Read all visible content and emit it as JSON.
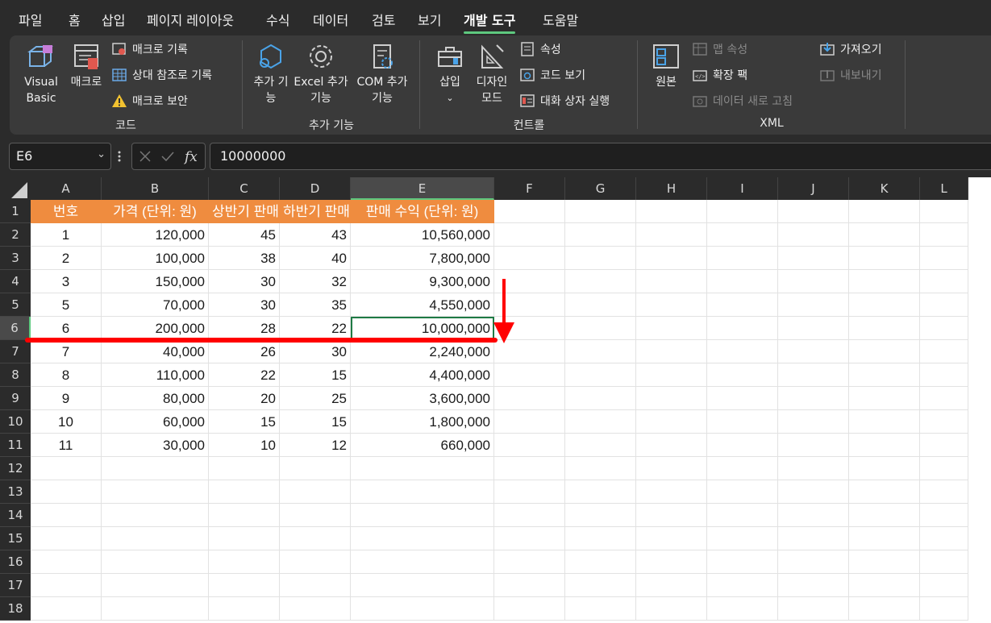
{
  "menu": {
    "tabs": [
      "파일",
      "홈",
      "삽입",
      "페이지 레이아웃",
      "수식",
      "데이터",
      "검토",
      "보기",
      "개발 도구",
      "도움말"
    ],
    "active_tab": "개발 도구"
  },
  "ribbon": {
    "code": {
      "label": "코드",
      "visual_basic": "Visual Basic",
      "macro": "매크로",
      "record_macro": "매크로 기록",
      "relative_ref": "상대 참조로 기록",
      "macro_security": "매크로 보안"
    },
    "addins": {
      "label": "추가 기능",
      "addins": "추가 기능",
      "excel_addins": "Excel 추가 기능",
      "com_addins": "COM 추가 기능"
    },
    "controls": {
      "label": "컨트롤",
      "insert": "삽입",
      "design_mode": "디자인 모드",
      "properties": "속성",
      "view_code": "코드 보기",
      "run_dialog": "대화 상자 실행"
    },
    "xml": {
      "label": "XML",
      "source": "원본",
      "map_properties": "맵 속성",
      "expansion_packs": "확장 팩",
      "refresh_data": "데이터 새로 고침",
      "import": "가져오기",
      "export": "내보내기"
    }
  },
  "formula_bar": {
    "name_box": "E6",
    "value": "10000000"
  },
  "sheet": {
    "columns": [
      "A",
      "B",
      "C",
      "D",
      "E",
      "F",
      "G",
      "H",
      "I",
      "J",
      "K",
      "L"
    ],
    "selected_column": "E",
    "selected_row": "6",
    "row_numbers": [
      "1",
      "2",
      "3",
      "4",
      "5",
      "6",
      "7",
      "8",
      "9",
      "10",
      "11",
      "12",
      "13",
      "14",
      "15",
      "16",
      "17",
      "18"
    ],
    "headers": [
      "번호",
      "가격 (단위: 원)",
      "상반기 판매량",
      "하반기 판매량",
      "판매 수익 (단위: 원)"
    ],
    "rows": [
      [
        "1",
        "120,000",
        "45",
        "43",
        "10,560,000"
      ],
      [
        "2",
        "100,000",
        "38",
        "40",
        "7,800,000"
      ],
      [
        "3",
        "150,000",
        "30",
        "32",
        "9,300,000"
      ],
      [
        "5",
        "70,000",
        "30",
        "35",
        "4,550,000"
      ],
      [
        "6",
        "200,000",
        "28",
        "22",
        "10,000,000"
      ],
      [
        "7",
        "40,000",
        "26",
        "30",
        "2,240,000"
      ],
      [
        "8",
        "110,000",
        "22",
        "15",
        "4,400,000"
      ],
      [
        "9",
        "80,000",
        "20",
        "25",
        "3,600,000"
      ],
      [
        "10",
        "60,000",
        "15",
        "15",
        "1,800,000"
      ],
      [
        "11",
        "30,000",
        "10",
        "12",
        "660,000"
      ]
    ]
  },
  "colors": {
    "header_fill": "#ef8c3f",
    "selection": "#1f7a45",
    "annotation": "#ff0000",
    "tab_underline": "#5ec97f"
  },
  "annotation": {
    "type": "red-line-and-down-arrow",
    "under_row": "6"
  }
}
